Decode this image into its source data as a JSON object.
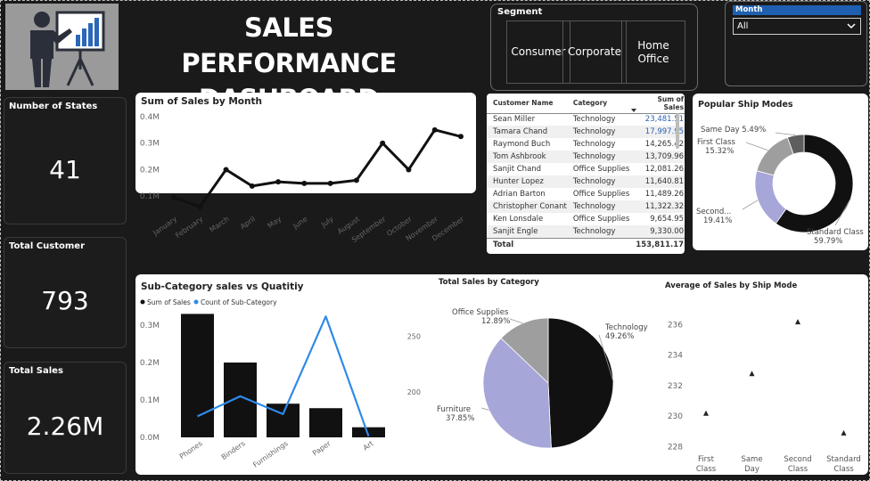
{
  "header": {
    "title_line1": "SALES PERFORMANCE",
    "title_line2": "DASHBOARD",
    "logo_icon": "presenter-chart-icon"
  },
  "segment_slicer": {
    "title": "Segment",
    "options": [
      "Consumer",
      "Corporate",
      "Home Office"
    ]
  },
  "month_slicer": {
    "title": "Month",
    "selected": "All"
  },
  "kpis": {
    "states": {
      "label": "Number of States",
      "value": "41"
    },
    "customers": {
      "label": "Total Customer",
      "value": "793"
    },
    "sales": {
      "label": "Total Sales",
      "value": "2.26M"
    }
  },
  "colors": {
    "background": "#1a1a1a",
    "black_series": "#111111",
    "blue_series": "#2f8ae8",
    "lavender": "#a6a6d8",
    "gray": "#9e9e9e",
    "link_blue": "#2d62b4"
  },
  "customer_table": {
    "headers": [
      "Customer Name",
      "Category",
      "Sum of Sales"
    ],
    "rows": [
      [
        "Sean Miller",
        "Technology",
        "23,481.51"
      ],
      [
        "Tamara Chand",
        "Technology",
        "17,997.95"
      ],
      [
        "Raymond Buch",
        "Technology",
        "14,265.42"
      ],
      [
        "Tom Ashbrook",
        "Technology",
        "13,709.96"
      ],
      [
        "Sanjit Chand",
        "Office Supplies",
        "12,081.26"
      ],
      [
        "Hunter Lopez",
        "Technology",
        "11,640.81"
      ],
      [
        "Adrian Barton",
        "Office Supplies",
        "11,489.26"
      ],
      [
        "Christopher Conant",
        "Technology",
        "11,322.32"
      ],
      [
        "Ken Lonsdale",
        "Office Supplies",
        "9,654.95"
      ],
      [
        "Sanjit Engle",
        "Technology",
        "9,330.00"
      ]
    ],
    "total_label": "Total",
    "total_value": "153,811.17"
  },
  "chart_data": [
    {
      "type": "line",
      "title": "Sum of Sales by Month",
      "categories": [
        "January",
        "February",
        "March",
        "April",
        "May",
        "June",
        "July",
        "August",
        "September",
        "October",
        "November",
        "December"
      ],
      "values": [
        0.095,
        0.06,
        0.2,
        0.138,
        0.154,
        0.148,
        0.148,
        0.16,
        0.3,
        0.2,
        0.35,
        0.325
      ],
      "ytick_labels": [
        "0.1M",
        "0.2M",
        "0.3M",
        "0.4M"
      ],
      "yticks": [
        0.1,
        0.2,
        0.3,
        0.4
      ],
      "ylim": [
        0.03,
        0.41
      ],
      "grid": false
    },
    {
      "type": "bar",
      "title": "Sub-Category sales vs Quatitiy",
      "categories": [
        "Phones",
        "Binders",
        "Furnishings",
        "Paper",
        "Art"
      ],
      "series": [
        {
          "name": "Sum of Sales",
          "values": [
            0.33,
            0.2,
            0.09,
            0.078,
            0.027
          ],
          "color": "#111111"
        },
        {
          "name": "Count of Sub-Category",
          "values": [
            178,
            196,
            180,
            268,
            160
          ],
          "color": "#2f8ae8"
        }
      ],
      "ytick_labels": [
        "0.0M",
        "0.1M",
        "0.2M",
        "0.3M"
      ],
      "yticks": [
        0,
        0.1,
        0.2,
        0.3
      ],
      "ylim": [
        0,
        0.35
      ],
      "y2tick_labels": [
        "200",
        "250"
      ],
      "y2ticks": [
        200,
        250
      ],
      "y2lim": [
        159,
        277
      ],
      "legend_position": "top-left"
    },
    {
      "type": "pie",
      "title": "Total Sales by Category",
      "slices": [
        {
          "label": "Technology",
          "pct_label": "49.26%",
          "value": 49.26,
          "color": "#111111"
        },
        {
          "label": "Furniture",
          "pct_label": "37.85%",
          "value": 37.85,
          "color": "#a6a6d8"
        },
        {
          "label": "Office Supplies",
          "pct_label": "12.89%",
          "value": 12.89,
          "color": "#9e9e9e"
        }
      ]
    },
    {
      "type": "pie",
      "title": "Popular Ship Modes",
      "donut": true,
      "slices": [
        {
          "label": "Standard Class",
          "pct_label": "59.79%",
          "value": 59.79,
          "color": "#111111"
        },
        {
          "label": "Second...",
          "pct_label": "19.41%",
          "value": 19.41,
          "color": "#a6a6d8"
        },
        {
          "label": "First Class",
          "pct_label": "15.32%",
          "value": 15.32,
          "color": "#9e9e9e"
        },
        {
          "label": "Same Day",
          "pct_label": "5.49%",
          "value": 5.49,
          "color": "#5e5e5e"
        }
      ]
    },
    {
      "type": "scatter",
      "title": "Average of Sales by Ship Mode",
      "categories": [
        "First Class",
        "Same Day",
        "Second Class",
        "Standard Class"
      ],
      "category_lines": [
        [
          "First",
          "Class"
        ],
        [
          "Same",
          "Day"
        ],
        [
          "Second",
          "Class"
        ],
        [
          "Standard",
          "Class"
        ]
      ],
      "values": [
        230.2,
        232.8,
        236.2,
        228.9
      ],
      "ytick_labels": [
        "228",
        "230",
        "232",
        "234",
        "236"
      ],
      "yticks": [
        228,
        230,
        232,
        234,
        236
      ],
      "ylim": [
        227.2,
        237.2
      ],
      "marker": "triangle"
    }
  ]
}
